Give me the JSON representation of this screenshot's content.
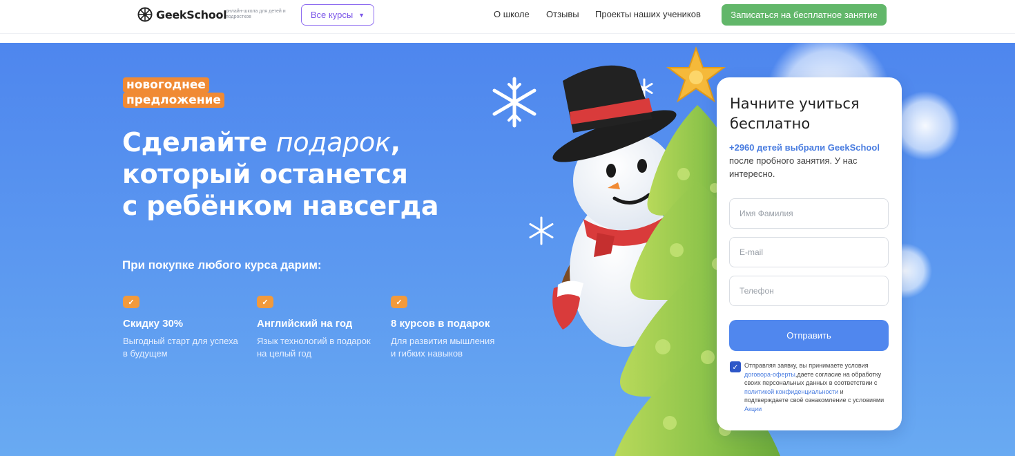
{
  "header": {
    "logo_text": "GeekSchool",
    "logo_subtitle": "онлайн-школа для детей и подростков",
    "courses_button": "Все курсы",
    "nav": [
      "О школе",
      "Отзывы",
      "Проекты наших учеников"
    ],
    "cta": "Записаться на бесплатное занятие"
  },
  "hero": {
    "badge_line1": "новогоднее",
    "badge_line2": "предложение",
    "headline_part1": "Сделайте ",
    "headline_italic": "подарок",
    "headline_part2": ",",
    "headline_line2": "который останется",
    "headline_line3": "с ребёнком навсегда",
    "subhead": "При покупке любого курса дарим:",
    "benefits": [
      {
        "title": "Скидку 30%",
        "desc_line1": "Выгодный старт для успеха",
        "desc_line2": "в будущем"
      },
      {
        "title": "Английский на год",
        "desc_line1": "Язык технологий в подарок",
        "desc_line2": "на целый год"
      },
      {
        "title": "8 курсов в подарок",
        "desc_line1": "Для развития мышления",
        "desc_line2": "и гибких навыков"
      }
    ]
  },
  "form": {
    "title_line1": "Начните учиться",
    "title_line2": "бесплатно",
    "text_highlight": "+2960 детей выбрали GeekSchool",
    "text_rest": " после пробного занятия. У нас интересно.",
    "name_placeholder": "Имя Фамилия",
    "email_placeholder": "E-mail",
    "phone_placeholder": "Телефон",
    "submit": "Отправить",
    "consent_checked": true,
    "consent_1": "Отправляя заявку, вы принимаете условия ",
    "consent_link1": "договора-оферты",
    "consent_2": ",даете согласие на обработку своих персональных данных в соответствии с ",
    "consent_link2": "политикой конфиденциальности",
    "consent_3": " и подтверждаете своё ознакомление с условиями ",
    "consent_link3": "Акции"
  },
  "colors": {
    "hero_bg": "#5c99f0",
    "accent_orange": "#f08a34",
    "cta_green": "#62b76a",
    "button_blue": "#5087ee",
    "purple": "#7a55e8"
  }
}
